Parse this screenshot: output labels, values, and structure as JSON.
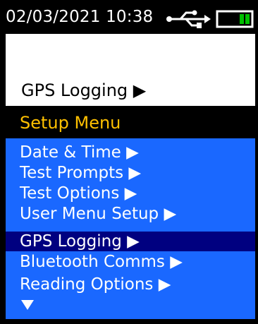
{
  "status_bar": {
    "datetime": "02/03/2021  10:38",
    "usb_icon": "usb-connected-icon",
    "battery_icon": "battery-charging-icon",
    "battery_color": "#00c000"
  },
  "current_selection": {
    "label": "GPS Logging ▶"
  },
  "menu": {
    "title": "Setup Menu",
    "items": [
      {
        "label": "Date & Time ▶"
      },
      {
        "label": "Test Prompts ▶"
      },
      {
        "label": "Test Options ▶"
      },
      {
        "label": "User Menu Setup ▶"
      },
      {
        "label": "GPS Logging ▶"
      },
      {
        "label": "Bluetooth Comms ▶"
      },
      {
        "label": "Reading Options ▶"
      }
    ],
    "selected_index": 4,
    "more_indicator": "down-arrow-icon"
  },
  "colors": {
    "background": "#000000",
    "menu_background": "#1a68ff",
    "menu_selected": "#000080",
    "menu_title": "#ffc000",
    "text_light": "#ffffff",
    "text_dark": "#000000"
  }
}
